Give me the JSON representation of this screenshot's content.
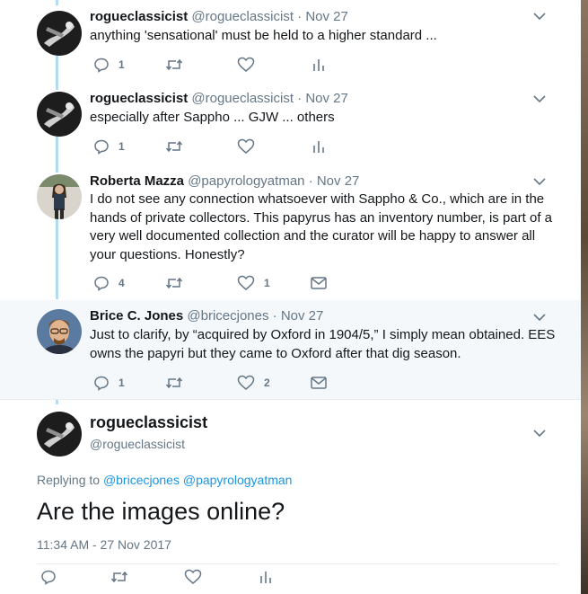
{
  "tweets": [
    {
      "name": "rogueclassicist",
      "handle": "@rogueclassicist",
      "date": "· Nov 27",
      "text": "anything 'sensational' must be held to a higher standard ...",
      "reply_count": "1",
      "retweet_count": "",
      "like_count": "",
      "extra_action": "analytics-icon"
    },
    {
      "name": "rogueclassicist",
      "handle": "@rogueclassicist",
      "date": "· Nov 27",
      "text": "especially after Sappho ... GJW ... others",
      "reply_count": "1",
      "retweet_count": "",
      "like_count": "",
      "extra_action": "analytics-icon"
    },
    {
      "name": "Roberta Mazza",
      "handle": "@papyrologyatman",
      "date": "· Nov 27",
      "text": "I do not see any connection whatsoever with Sappho & Co., which are in the hands of private collectors. This papyrus has an inventory number, is part of a very well documented collection and the curator will be happy to answer all your questions. Honestly?",
      "reply_count": "4",
      "retweet_count": "",
      "like_count": "1",
      "extra_action": "envelope-icon"
    },
    {
      "name": "Brice C. Jones",
      "handle": "@bricecjones",
      "date": "· Nov 27",
      "text": "Just to clarify, by “acquired by Oxford in 1904/5,” I simply mean obtained. EES owns the papyri but they came to Oxford after that dig season.",
      "reply_count": "1",
      "retweet_count": "",
      "like_count": "2",
      "extra_action": "envelope-icon"
    }
  ],
  "focused": {
    "name": "rogueclassicist",
    "handle": "@rogueclassicist",
    "replying_label": "Replying to",
    "replying_to": [
      "@bricecjones",
      "@papyrologyatman"
    ],
    "text": "Are the images online?",
    "timestamp": "11:34 AM - 27 Nov 2017"
  },
  "colors": {
    "icon": "#657786",
    "link": "#1b95e0",
    "thread_line": "#b3dcf2",
    "highlight_bg": "#f5f8fa"
  }
}
